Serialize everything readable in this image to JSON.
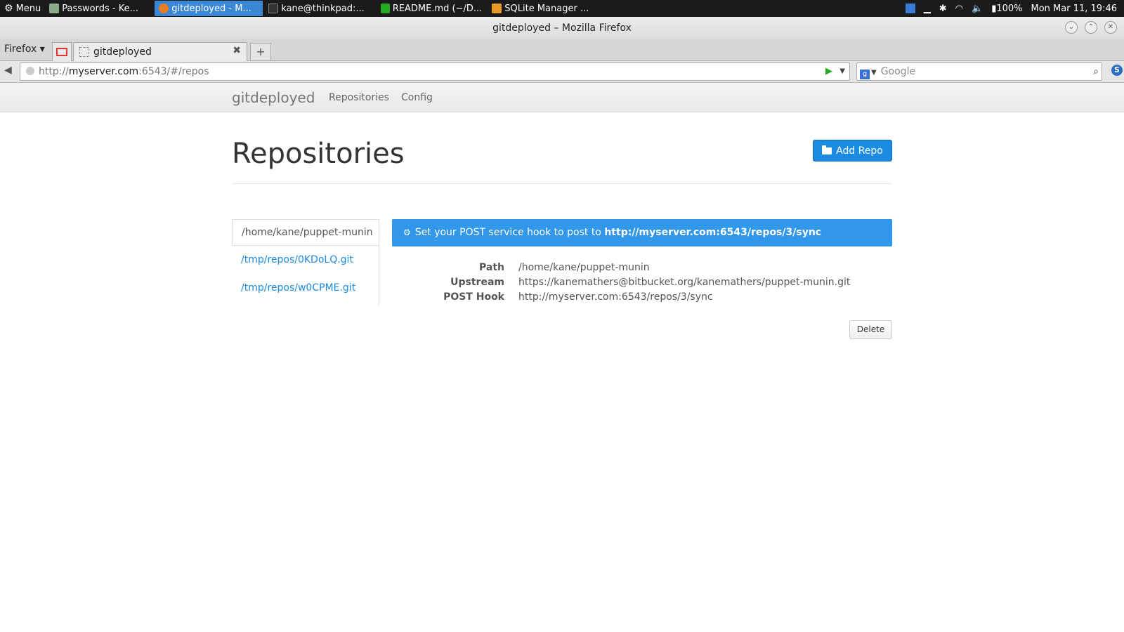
{
  "system_panel": {
    "menu_label": "Menu",
    "tasks": [
      {
        "label": "Passwords - Ke...",
        "active": false
      },
      {
        "label": "gitdeployed - M...",
        "active": true
      },
      {
        "label": "kane@thinkpad:...",
        "active": false
      },
      {
        "label": "README.md (~/D...",
        "active": false
      },
      {
        "label": "SQLite Manager ...",
        "active": false
      }
    ],
    "battery": "100%",
    "clock": "Mon Mar 11, 19:46"
  },
  "window": {
    "title": "gitdeployed – Mozilla Firefox"
  },
  "browser": {
    "menu_label": "Firefox ▾",
    "tab_title": "gitdeployed",
    "url_prefix": "http://",
    "url_host": "myserver.com",
    "url_rest": ":6543/#/repos",
    "search_placeholder": "Google"
  },
  "app": {
    "brand": "gitdeployed",
    "nav": [
      "Repositories",
      "Config"
    ],
    "page_title": "Repositories",
    "add_button": "Add Repo",
    "repos": [
      "/home/kane/puppet-munin",
      "/tmp/repos/0KDoLQ.git",
      "/tmp/repos/w0CPME.git"
    ],
    "alert": {
      "text": "Set your POST service hook to post to ",
      "link": "http://myserver.com:6543/repos/3/sync"
    },
    "details": [
      {
        "label": "Path",
        "value": "/home/kane/puppet-munin"
      },
      {
        "label": "Upstream",
        "value": "https://kanemathers@bitbucket.org/kanemathers/puppet-munin.git"
      },
      {
        "label": "POST Hook",
        "value": "http://myserver.com:6543/repos/3/sync"
      }
    ],
    "delete_button": "Delete"
  },
  "colors": {
    "primary": "#1a8be0",
    "alert": "#3197ea",
    "active_task": "#3a87d6"
  }
}
